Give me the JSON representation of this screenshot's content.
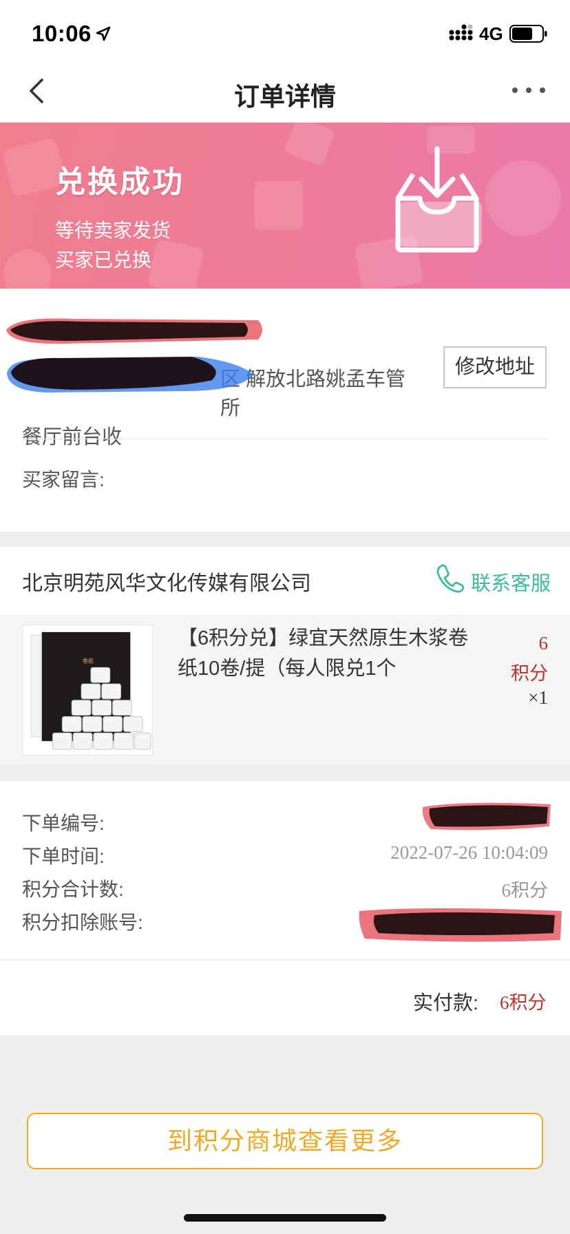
{
  "status_bar": {
    "time": "10:06",
    "network": "4G"
  },
  "nav": {
    "title": "订单详情",
    "back_icon": "chevron-left-icon",
    "more_icon": "more-dots-icon"
  },
  "banner": {
    "title": "兑换成功",
    "line1": "等待卖家发货",
    "line2": "买家已兑换",
    "icon": "inbox-download-icon"
  },
  "address": {
    "line1": "区 解放北路姚孟车管所",
    "line2": "餐厅前台收",
    "edit_label": "修改地址"
  },
  "buyer_message_label": "买家留言:",
  "shop": {
    "name": "北京明苑风华文化传媒有限公司",
    "contact_label": "联系客服",
    "contact_icon": "phone-icon"
  },
  "product": {
    "name": "【6积分兑】绿宜天然原生木浆卷纸10卷/提（每人限兑1个",
    "price_value": "6",
    "price_unit": "积分",
    "quantity": "×1"
  },
  "order_info": {
    "order_no_label": "下单编号:",
    "order_time_label": "下单时间:",
    "order_time": "2022-07-26 10:04:09",
    "points_total_label": "积分合计数:",
    "points_total": "6积分",
    "deduct_account_label": "积分扣除账号:"
  },
  "payment": {
    "label": "实付款:",
    "value": "6积分"
  },
  "mall_button": "到积分商城查看更多",
  "colors": {
    "banner_start": "#f07e8c",
    "banner_end": "#ea7aa8",
    "accent_red": "#c0332b",
    "contact_green": "#3fbba0",
    "button_orange": "#f0a927"
  }
}
